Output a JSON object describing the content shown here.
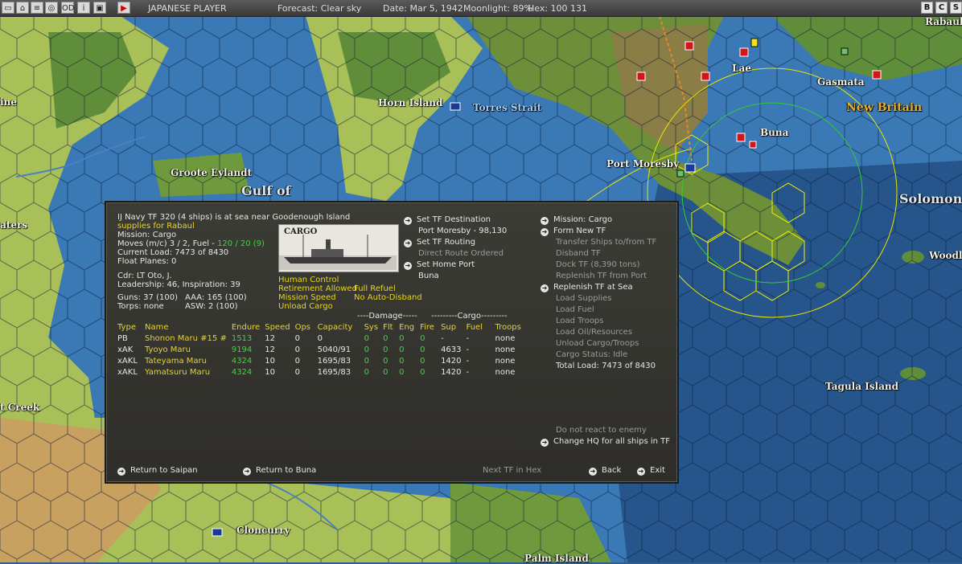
{
  "toolbar": {
    "icons": [
      "window-icon",
      "home-icon",
      "list-icon",
      "globe-icon",
      "od-icon",
      "info-icon",
      "screen-icon",
      "play-icon"
    ],
    "od_label": "OD",
    "player": "JAPANESE PLAYER",
    "forecast": "Forecast: Clear sky",
    "date": "Date: Mar 5, 1942",
    "moonlight": "Moonlight: 89%",
    "hex": "Hex: 100 131",
    "right_buttons": [
      "B",
      "C",
      "S"
    ]
  },
  "map": {
    "labels": {
      "lae": "Lae",
      "gasmata": "Gasmata",
      "new_britain": "New Britain",
      "rabaul": "Rabaul",
      "horn_island": "Horn Island",
      "torres_strait": "Torres Strait",
      "buna": "Buna",
      "port_moresby": "Port Moresby",
      "groote_eylandt": "Groote Eylandt",
      "gulf_of": "Gulf of",
      "solomon": "Solomon",
      "woodlark": "Woodla",
      "tagula_island": "Tagula Island",
      "cloncurry": "Cloncurry",
      "palm_island": "Palm Island",
      "creek": "t Creek",
      "aters": "aters",
      "ine": "ine"
    }
  },
  "panel": {
    "header": "IJ Navy TF 320 (4 ships) is at sea near Goodenough Island",
    "supplies": "supplies for Rabaul",
    "mission": "Mission: Cargo",
    "moves": "Moves (m/c) 3 / 2, Fuel -",
    "fuel": "120 / 20 (9)",
    "current_load": "Current Load: 7473 of 8430",
    "float_planes": "Float Planes: 0",
    "cdr": "Cdr: LT Oto, J.",
    "leadership": "Leadership: 46, Inspiration: 39",
    "guns": "Guns: 37 (100)",
    "aaa": "AAA: 165 (100)",
    "torps": "Torps: none",
    "asw": "ASW: 2 (100)",
    "ship_image_label": "CARGO",
    "human_control": "Human Control",
    "retirement": "Retirement Allowed",
    "full_refuel": "Full Refuel",
    "mission_speed": "Mission Speed",
    "no_auto_disband": "No Auto-Disband",
    "unload_cargo": "Unload Cargo",
    "set_tf_destination": "Set TF Destination",
    "port_moresby": "Port Moresby - 98,130",
    "set_tf_routing": "Set TF Routing",
    "direct_route": "Direct Route Ordered",
    "set_home_port": "Set Home Port",
    "home_port": "Buna",
    "right_menu": {
      "mission_cargo": "Mission: Cargo",
      "form_new_tf": "Form New TF",
      "transfer_ships": "Transfer Ships to/from TF",
      "disband_tf": "Disband TF",
      "dock_tf": "Dock TF (8,390 tons)",
      "replenish_port": "Replenish TF from Port",
      "replenish_sea": "Replenish TF at Sea",
      "load_supplies": "Load Supplies",
      "load_fuel": "Load Fuel",
      "load_troops": "Load Troops",
      "load_oil": "Load Oil/Resources",
      "unload_cargo_troops": "Unload Cargo/Troops",
      "cargo_status": "Cargo Status: Idle",
      "total_load": "Total Load: 7473 of 8430",
      "do_not_react": "Do not react to enemy",
      "change_hq": "Change HQ for all ships in TF"
    },
    "damage_header": "----Damage-----",
    "cargo_header": "---------Cargo---------",
    "columns": [
      "Type",
      "Name",
      "Endure",
      "Speed",
      "Ops",
      "Capacity",
      "Sys",
      "Flt",
      "Eng",
      "Fire",
      "Sup",
      "Fuel",
      "Troops"
    ],
    "ships": [
      {
        "type": "PB",
        "name": "Shonon Maru #15 #",
        "endure": "1513",
        "speed": "12",
        "ops": "0",
        "capacity": "0",
        "sys": "0",
        "flt": "0",
        "eng": "0",
        "fire": "0",
        "sup": "-",
        "fuel": "-",
        "troops": "none"
      },
      {
        "type": "xAK",
        "name": "Tyoyo Maru",
        "endure": "9194",
        "speed": "12",
        "ops": "0",
        "capacity": "5040/91",
        "sys": "0",
        "flt": "0",
        "eng": "0",
        "fire": "0",
        "sup": "4633",
        "fuel": "-",
        "troops": "none"
      },
      {
        "type": "xAKL",
        "name": "Tateyama Maru",
        "endure": "4324",
        "speed": "10",
        "ops": "0",
        "capacity": "1695/83",
        "sys": "0",
        "flt": "0",
        "eng": "0",
        "fire": "0",
        "sup": "1420",
        "fuel": "-",
        "troops": "none"
      },
      {
        "type": "xAKL",
        "name": "Yamatsuru Maru",
        "endure": "4324",
        "speed": "10",
        "ops": "0",
        "capacity": "1695/83",
        "sys": "0",
        "flt": "0",
        "eng": "0",
        "fire": "0",
        "sup": "1420",
        "fuel": "-",
        "troops": "none"
      }
    ],
    "return_saipan": "Return to Saipan",
    "return_buna": "Return to Buna",
    "next_tf": "Next TF in Hex",
    "back": "Back",
    "exit": "Exit"
  }
}
